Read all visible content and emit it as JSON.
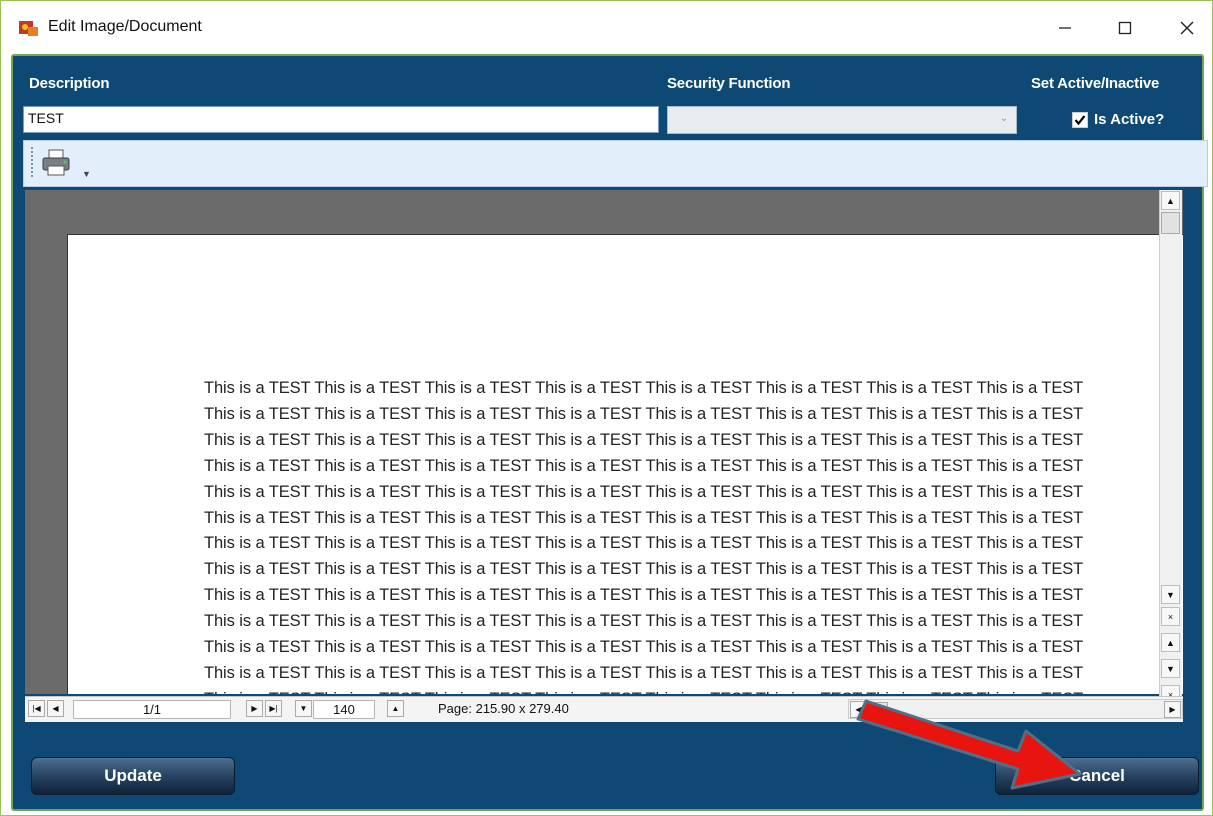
{
  "window": {
    "title": "Edit Image/Document"
  },
  "fields": {
    "description_label": "Description",
    "description_value": "TEST",
    "security_label": "Security Function",
    "security_value": "",
    "active_label": "Set Active/Inactive",
    "is_active_label": "Is Active?",
    "is_active_checked": true
  },
  "toolbar": {
    "icons": [
      "print-icon",
      "overflow-chevron-icon"
    ]
  },
  "document": {
    "lines": [
      "This is a TEST This is a TEST This is a TEST This is a TEST This is a TEST This is a TEST This is a TEST This is a TEST",
      "This is a TEST This is a TEST This is a TEST This is a TEST This is a TEST This is a TEST This is a TEST This is a TEST",
      "This is a TEST This is a TEST This is a TEST This is a TEST This is a TEST This is a TEST This is a TEST This is a TEST",
      "This is a TEST This is a TEST This is a TEST This is a TEST This is a TEST This is a TEST This is a TEST This is a TEST",
      "This is a TEST This is a TEST This is a TEST This is a TEST This is a TEST This is a TEST This is a TEST This is a TEST",
      "This is a TEST This is a TEST This is a TEST This is a TEST This is a TEST This is a TEST This is a TEST This is a TEST",
      "This is a TEST This is a TEST This is a TEST This is a TEST This is a TEST This is a TEST This is a TEST This is a TEST",
      "This is a TEST This is a TEST This is a TEST This is a TEST This is a TEST This is a TEST This is a TEST This is a TEST",
      "This is a TEST This is a TEST This is a TEST This is a TEST This is a TEST This is a TEST This is a TEST This is a TEST",
      "This is a TEST This is a TEST This is a TEST This is a TEST This is a TEST This is a TEST This is a TEST This is a TEST",
      "This is a TEST This is a TEST This is a TEST This is a TEST This is a TEST This is a TEST This is a TEST This is a TEST",
      "This is a TEST This is a TEST This is a TEST This is a TEST This is a TEST This is a TEST This is a TEST This is a TEST",
      "This is a TEST This is a TEST This is a TEST This is a TEST This is a TEST This is a TEST This is a TEST This is a TEST"
    ]
  },
  "navigation": {
    "page_value": "1/1",
    "zoom_value": "140",
    "page_size": "Page: 215.90 x 279.40"
  },
  "buttons": {
    "update": "Update",
    "cancel": "Cancel"
  },
  "colors": {
    "panel_bg": "#0e4874",
    "border_green": "#6fa850",
    "toolbar_bg": "#e3eefb",
    "viewer_bg": "#6b6b6b",
    "annotation_arrow": "#e8140f"
  }
}
